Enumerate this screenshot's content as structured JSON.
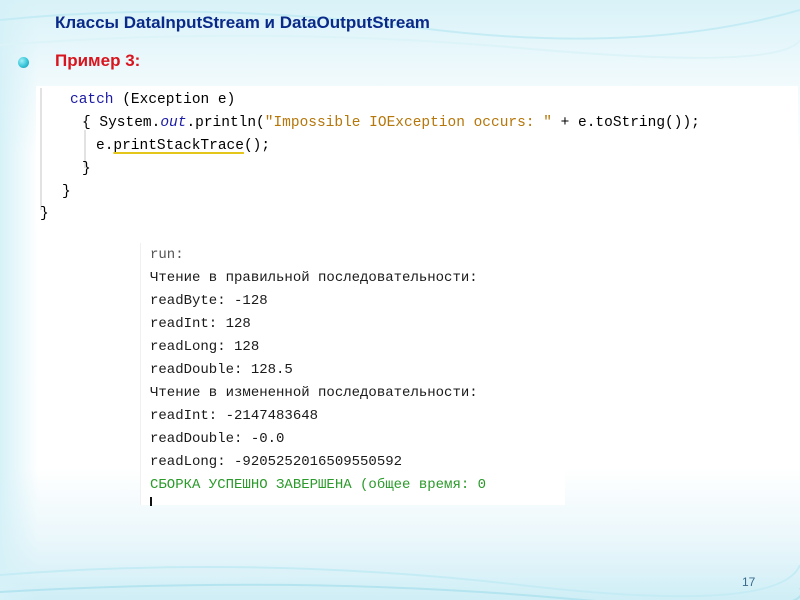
{
  "slide": {
    "title": "Классы DataInputStream и DataOutputStream",
    "subtitle": "Пример 3:",
    "page_number": "17"
  },
  "code": {
    "line1": {
      "kw": "catch",
      "rest": " (Exception e)"
    },
    "line2": {
      "open": "{ System.",
      "out": "out",
      "call": ".println(",
      "str": "\"Impossible IOException occurs: \"",
      "tail": " + e.toString());"
    },
    "line3": {
      "obj": "e.",
      "method": "printStackTrace",
      "tail": "();"
    },
    "line4": "}",
    "line5": "}",
    "line6": "}"
  },
  "output": {
    "lines": [
      "run:",
      "Чтение в правильной последовательности:",
      "readByte: -128",
      "readInt: 128",
      "readLong: 128",
      "readDouble: 128.5",
      "Чтение в измененной последовательности:",
      "readInt: -2147483648",
      "readDouble: -0.0",
      "readLong: -9205252016509550592",
      "СБОРКА УСПЕШНО ЗАВЕРШЕНА (общее время: 0"
    ]
  },
  "colors": {
    "title": "#0a2a8a",
    "subtitle": "#d8141e",
    "keyword": "#1a1aa6",
    "string": "#b5760a",
    "success": "#2a9a2a"
  }
}
